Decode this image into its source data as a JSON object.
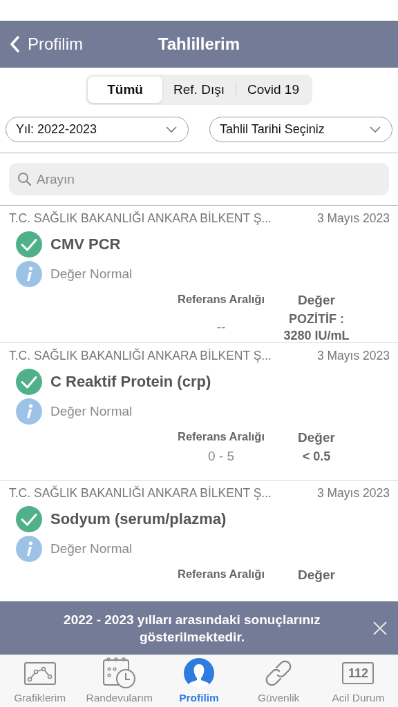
{
  "nav": {
    "back_label": "Profilim",
    "title": "Tahlillerim"
  },
  "segments": [
    {
      "label": "Tümü",
      "selected": true
    },
    {
      "label": "Ref. Dışı",
      "selected": false
    },
    {
      "label": "Covid 19",
      "selected": false
    }
  ],
  "filters": [
    {
      "value": "Yıl: 2022-2023"
    },
    {
      "value": "Tahlil Tarihi Seçiniz"
    }
  ],
  "search": {
    "placeholder": "Arayın"
  },
  "results": [
    {
      "institution": "T.C. SAĞLIK BAKANLIĞI ANKARA BİLKENT Ş...",
      "date": "3 Mayıs 2023",
      "test": "CMV PCR",
      "status": "Değer Normal",
      "range_label": "Referans Aralığı",
      "value_label": "Değer",
      "range": "--",
      "value": "POZİTİF : 3280 IU/mL"
    },
    {
      "institution": "T.C. SAĞLIK BAKANLIĞI ANKARA BİLKENT Ş...",
      "date": "3 Mayıs 2023",
      "test": "C Reaktif Protein (crp)",
      "status": "Değer Normal",
      "range_label": "Referans Aralığı",
      "value_label": "Değer",
      "range": "0 - 5",
      "value": "< 0.5"
    },
    {
      "institution": "T.C. SAĞLIK BAKANLIĞI ANKARA BİLKENT Ş...",
      "date": "3 Mayıs 2023",
      "test": "Sodyum (serum/plazma)",
      "status": "Değer Normal",
      "range_label": "Referans Aralığı",
      "value_label": "Değer"
    }
  ],
  "toast": {
    "message": "2022 - 2023 yılları arasındaki sonuçlarınız gösterilmektedir."
  },
  "tabs": [
    {
      "label": "Grafiklerim",
      "kind": "chart",
      "selected": false
    },
    {
      "label": "Randevularım",
      "kind": "calendar",
      "selected": false
    },
    {
      "label": "Profilim",
      "kind": "profile",
      "selected": true
    },
    {
      "label": "Güvenlik",
      "kind": "link",
      "selected": false
    },
    {
      "label": "Acil Durum",
      "kind": "emergency",
      "icon_text": "112",
      "selected": false
    }
  ]
}
